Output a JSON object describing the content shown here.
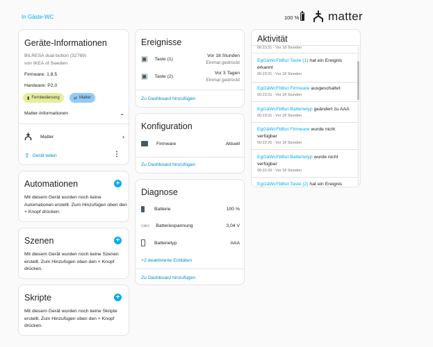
{
  "header": {
    "area": "In Gäste-WC",
    "battery": "100 %",
    "logo_text": "matter"
  },
  "device_info": {
    "title": "Geräte-Informationen",
    "model": "BILRESA dual button (32769)",
    "manufacturer": "von IKEA of Sweden",
    "firmware": "Firmware: 1.8.5",
    "hardware": "Hardware: P2.0",
    "badges": [
      "Fernbedienung",
      "Matter"
    ],
    "matter_info_label": "Matter-Informationen",
    "matter_row": "Matter",
    "share_label": "Gerät teilen"
  },
  "automations": {
    "title": "Automationen",
    "text": "Mit diesem Gerät wurden noch keine Automationen erstellt. Zum Hinzufügen oben den + Knopf drücken."
  },
  "scenes": {
    "title": "Szenen",
    "text": "Mit diesem Gerät wurden noch keine Szenen erstellt. Zum Hinzufügen oben den + Knopf drücken."
  },
  "scripts": {
    "title": "Skripte",
    "text": "Mit diesem Gerät wurden noch keine Skripte erstellt. Zum Hinzufügen oben den + Knopf drücken."
  },
  "events": {
    "title": "Ereignisse",
    "items": [
      {
        "name": "Taste (1)",
        "time": "Vor 18 Stunden",
        "state": "Einmal gedrückt"
      },
      {
        "name": "Taste (2)",
        "time": "Vor 3 Tagen",
        "state": "Einmal gedrückt"
      }
    ],
    "dashboard_link": "Zu Dashboard hinzufügen"
  },
  "config": {
    "title": "Konfiguration",
    "items": [
      {
        "name": "Firmware",
        "value": "Aktuell"
      }
    ],
    "dashboard_link": "Zu Dashboard hinzufügen"
  },
  "diagnostics": {
    "title": "Diagnose",
    "items": [
      {
        "name": "Batterie",
        "value": "100 %"
      },
      {
        "name": "Batteriespannung",
        "value": "3,04 V"
      },
      {
        "name": "Batterietyp",
        "value": "AAA"
      }
    ],
    "disabled_link": "+2 deaktivierte Entitäten",
    "dashboard_link": "Zu Dashboard hinzufügen"
  },
  "activity": {
    "title": "Aktivität",
    "top_partial_time": "00:23:31 - Vor 18 Stunden",
    "entries": [
      {
        "device": "EgGäWcFbBut",
        "entity": "Taste (1)",
        "text1": " hat ein Ereignis",
        "text2": "erkannt",
        "time": "00:23:31 - Vor 18 Stunden"
      },
      {
        "device": "EgGäWcFbBut",
        "entity": "Firmware",
        "text1": " ausgeschaltet",
        "text2": "",
        "time": "00:23:31 - Vor 18 Stunden"
      },
      {
        "device": "EgGäWcFbBut",
        "entity": "Batterietyp",
        "text1": " geändert zu AAA",
        "text2": "",
        "time": "00:23:31 - Vor 18 Stunden"
      },
      {
        "device": "EgGäWcFbBut",
        "entity": "Firmware",
        "text1": " wurde nicht",
        "text2": "verfügbar",
        "time": "00:22:26 - Vor 18 Stunden"
      },
      {
        "device": "EgGäWcFbBut",
        "entity": "Batterietyp",
        "text1": " wurde nicht",
        "text2": "verfügbar",
        "time": "00:22:26 - Vor 18 Stunden"
      },
      {
        "device": "EgGäWcFbBut",
        "entity": "Taste (2)",
        "text1": " hat ein Ereignis",
        "text2": "",
        "time": ""
      }
    ]
  },
  "colors": {
    "accent": "#03a9f4",
    "badge_yellow": "#e6ee9c",
    "badge_blue": "#90caf9"
  }
}
